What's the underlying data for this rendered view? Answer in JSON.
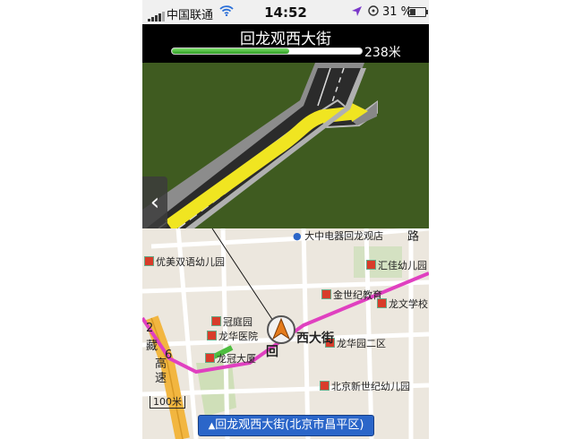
{
  "status_bar": {
    "carrier": "中国联通",
    "time": "14:52",
    "battery": "31 %"
  },
  "nav": {
    "road_name": "回龙观西大街",
    "distance": "238米",
    "progress": 0.62
  },
  "back_button": "‹",
  "map": {
    "labels": {
      "dazhong": "大中电器回龙观店",
      "lu": "路",
      "youmei": "优美双语幼儿园",
      "huijia": "汇佳幼儿园",
      "jinshiji": "金世纪教育",
      "longwen": "龙文学校",
      "guanting": "冠庭园",
      "longhua_hospital": "龙华医院",
      "hui": "回",
      "xidajie": "西大街",
      "longhua2": "龙华园二区",
      "longguan": "龙冠大厦",
      "beijing_xinshiji": "北京新世纪幼儿园",
      "zang": "藏",
      "gao": "高",
      "su": "速",
      "num2": "2",
      "num6": "6"
    },
    "scale": "100米"
  },
  "bottom_bar": "回龙观西大街(北京市昌平区)",
  "colors": {
    "grass": "#3f5b20",
    "route_arrow": "#f0e521",
    "route_line": "#e040c0",
    "highway": "#f2b640",
    "bottom_bar": "#2b66c9"
  }
}
